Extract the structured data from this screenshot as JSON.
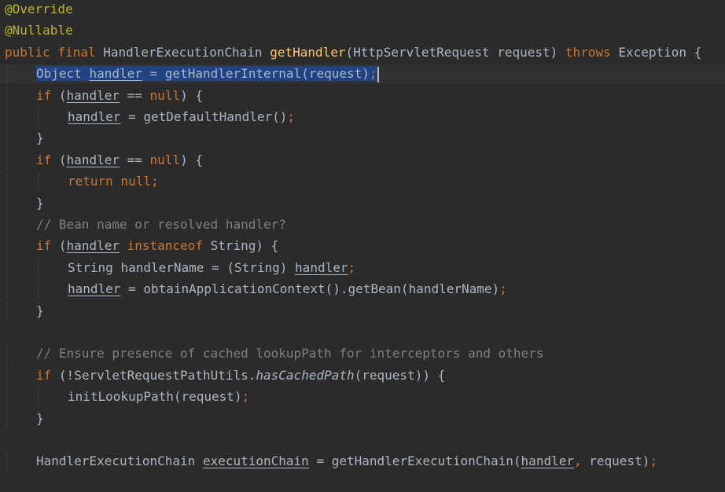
{
  "editor": {
    "lines": [
      {
        "indent": 0,
        "text": "@Override"
      },
      {
        "indent": 0,
        "text": "@Nullable"
      },
      {
        "indent": 0,
        "text": "public final HandlerExecutionChain getHandler(HttpServletRequest request) throws Exception {"
      },
      {
        "indent": 1,
        "text": "Object handler = getHandlerInternal(request);"
      },
      {
        "indent": 1,
        "text": "if (handler == null) {"
      },
      {
        "indent": 2,
        "text": "handler = getDefaultHandler();"
      },
      {
        "indent": 1,
        "text": "}"
      },
      {
        "indent": 1,
        "text": "if (handler == null) {"
      },
      {
        "indent": 2,
        "text": "return null;"
      },
      {
        "indent": 1,
        "text": "}"
      },
      {
        "indent": 1,
        "text": "// Bean name or resolved handler?"
      },
      {
        "indent": 1,
        "text": "if (handler instanceof String) {"
      },
      {
        "indent": 2,
        "text": "String handlerName = (String) handler;"
      },
      {
        "indent": 2,
        "text": "handler = obtainApplicationContext().getBean(handlerName);"
      },
      {
        "indent": 1,
        "text": "}"
      },
      {
        "indent": 0,
        "text": ""
      },
      {
        "indent": 1,
        "text": "// Ensure presence of cached lookupPath for interceptors and others"
      },
      {
        "indent": 1,
        "text": "if (!ServletRequestPathUtils.hasCachedPath(request)) {"
      },
      {
        "indent": 2,
        "text": "initLookupPath(request);"
      },
      {
        "indent": 1,
        "text": "}"
      },
      {
        "indent": 0,
        "text": ""
      },
      {
        "indent": 1,
        "text": "HandlerExecutionChain executionChain = getHandlerExecutionChain(handler, request);"
      }
    ],
    "selected_line": 3,
    "colors": {
      "background": "#2b2b2b",
      "text": "#a9b7c6",
      "keyword": "#cc7832",
      "annotation": "#bbb529",
      "method": "#ffc66d",
      "comment": "#808080",
      "selection": "#214283"
    }
  }
}
